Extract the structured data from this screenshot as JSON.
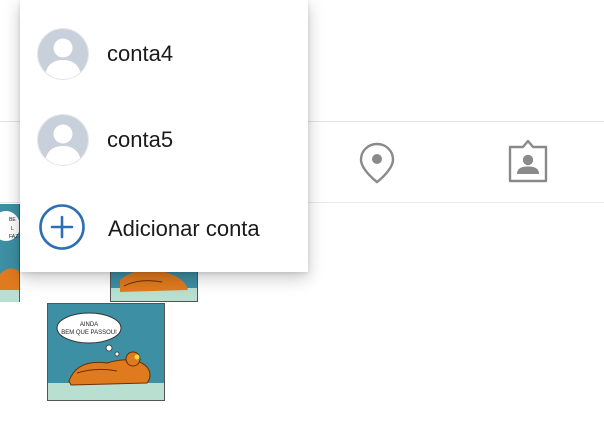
{
  "account_menu": {
    "accounts": [
      {
        "label": "conta4",
        "avatar_icon": "default-avatar-icon"
      },
      {
        "label": "conta5",
        "avatar_icon": "default-avatar-icon"
      }
    ],
    "add_account": {
      "label": "Adicionar conta",
      "icon": "plus-circle-icon",
      "color": "#2c6fb2"
    }
  },
  "profile_tabs": [
    {
      "name": "tab-location",
      "icon": "location-pin-icon"
    },
    {
      "name": "tab-tagged",
      "icon": "tagged-person-icon"
    }
  ],
  "posts": [
    {
      "name": "post-thumbnail-1",
      "content": "comic"
    },
    {
      "name": "post-thumbnail-2",
      "content": "comic"
    },
    {
      "name": "post-thumbnail-3",
      "content": "comic",
      "caption": "AINDA BEM QUE PASSOU!"
    }
  ],
  "colors": {
    "background": "#ffffff",
    "icon_gray": "#8a8a8a",
    "avatar_bg": "#c8d0dc",
    "accent": "#2c6fb2"
  }
}
